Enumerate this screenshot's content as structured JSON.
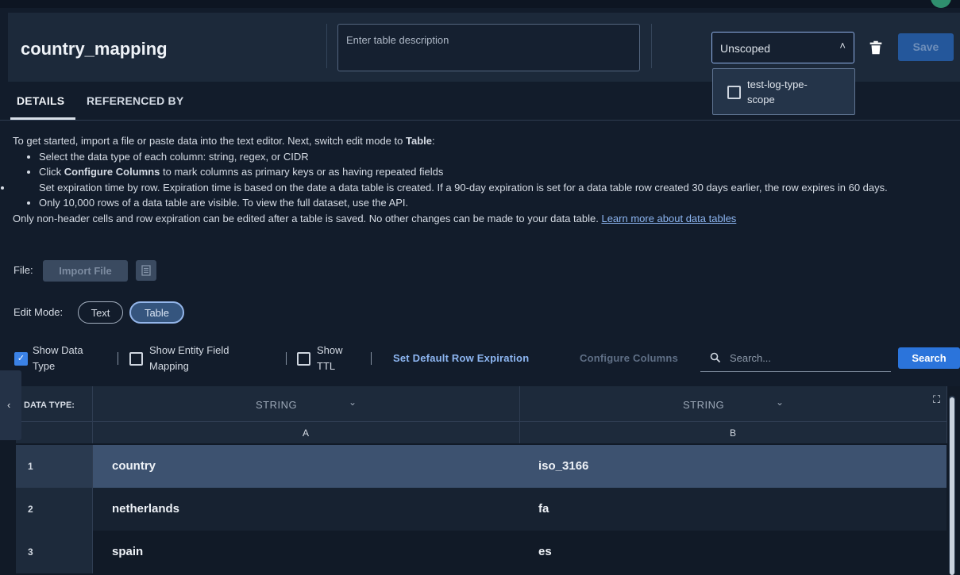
{
  "header": {
    "table_name": "country_mapping",
    "description_placeholder": "Enter table description",
    "scope_value": "Unscoped",
    "save_label": "Save"
  },
  "scope_dropdown": {
    "options": [
      {
        "label": "test-log-type-scope",
        "checked": false
      }
    ]
  },
  "tabs": [
    {
      "label": "DETAILS",
      "active": true
    },
    {
      "label": "REFERENCED BY",
      "active": false
    }
  ],
  "instructions": {
    "intro_prefix": "To get started, import a file or paste data into the text editor. Next, switch edit mode to ",
    "intro_bold": "Table",
    "intro_suffix": ":",
    "bullet1": "Select the data type of each column: string, regex, or CIDR",
    "bullet2_prefix": "Click ",
    "bullet2_bold": "Configure Columns",
    "bullet2_suffix": " to mark columns as primary keys or as having repeated fields",
    "bullet3": "Set expiration time by row. Expiration time is based on the date a data table is created. If a 90-day expiration is set for a data table row created 30 days earlier, the row expires in 60 days.",
    "bullet4": "Only 10,000 rows of a data table are visible. To view the full dataset, use the API.",
    "outro": "Only non-header cells and row expiration can be edited after a table is saved. No other changes can be made to your data table. ",
    "link": "Learn more about data tables"
  },
  "file": {
    "label": "File:",
    "import_label": "Import File"
  },
  "edit_mode": {
    "label": "Edit Mode:",
    "options": [
      "Text",
      "Table"
    ],
    "selected": "Table"
  },
  "toolbar": {
    "show_data_type_line1": "Show Data",
    "show_data_type_line2": "Type",
    "show_data_type_checked": true,
    "show_entity_line1": "Show Entity Field",
    "show_entity_line2": "Mapping",
    "show_entity_checked": false,
    "show_ttl_line1": "Show",
    "show_ttl_line2": "TTL",
    "show_ttl_checked": false,
    "default_expiration": "Set Default Row Expiration",
    "configure_columns": "Configure Columns",
    "search_placeholder": "Search...",
    "search_button": "Search"
  },
  "grid": {
    "data_type_label": "DATA TYPE:",
    "columns": [
      {
        "type": "STRING",
        "letter": "A"
      },
      {
        "type": "STRING",
        "letter": "B"
      }
    ],
    "rows": [
      {
        "num": "1",
        "a": "country",
        "b": "iso_3166"
      },
      {
        "num": "2",
        "a": "netherlands",
        "b": "fa"
      },
      {
        "num": "3",
        "a": "spain",
        "b": "es"
      }
    ]
  },
  "colors": {
    "accent": "#2b74db",
    "background": "#121c2b",
    "header_bg": "#1c293a",
    "selected_row": "#3d5270"
  },
  "icons": [
    "trash-icon",
    "chevron-up-icon",
    "file-icon",
    "check-icon",
    "search-icon",
    "chevron-down-icon",
    "chevron-left-icon",
    "expand-icon"
  ]
}
